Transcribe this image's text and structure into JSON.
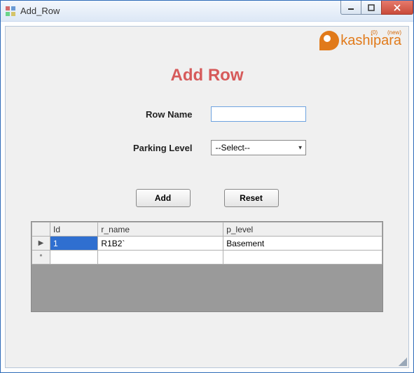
{
  "window": {
    "title": "Add_Row"
  },
  "logo": {
    "text": "kashipara",
    "tag1": "(0)",
    "tag2": "(new)"
  },
  "page": {
    "heading": "Add Row"
  },
  "form": {
    "row_name_label": "Row Name",
    "row_name_value": "",
    "parking_level_label": "Parking Level",
    "parking_level_selected": "--Select--"
  },
  "buttons": {
    "add": "Add",
    "reset": "Reset"
  },
  "grid": {
    "columns": [
      "Id",
      "r_name",
      "p_level"
    ],
    "rows": [
      {
        "Id": "1",
        "r_name": "R1B2`",
        "p_level": "Basement"
      }
    ]
  }
}
